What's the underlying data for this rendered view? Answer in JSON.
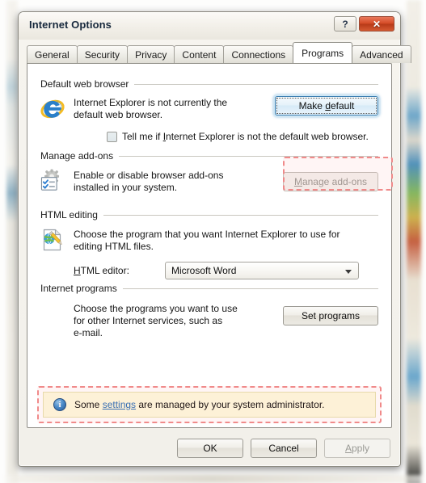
{
  "window": {
    "title": "Internet Options",
    "help_button": "?",
    "close_button": "✕"
  },
  "tabs": [
    {
      "label": "General",
      "active": false
    },
    {
      "label": "Security",
      "active": false
    },
    {
      "label": "Privacy",
      "active": false
    },
    {
      "label": "Content",
      "active": false
    },
    {
      "label": "Connections",
      "active": false
    },
    {
      "label": "Programs",
      "active": true
    },
    {
      "label": "Advanced",
      "active": false
    }
  ],
  "sections": {
    "default_browser": {
      "heading": "Default web browser",
      "icon": "internet-explorer-icon",
      "description_line1": "Internet Explorer is not currently the",
      "description_line2": "default web browser.",
      "button_label": "Make default",
      "button_accel": "d",
      "button_state": "focused",
      "checkbox_label_pre": "Tell me if ",
      "checkbox_accel": "I",
      "checkbox_label_post": "nternet Explorer is not the default web browser.",
      "checkbox_checked": false
    },
    "manage_addons": {
      "heading": "Manage add-ons",
      "icon": "addons-gear-icon",
      "description_line1": "Enable or disable browser add-ons",
      "description_line2": "installed in your system.",
      "button_accel": "M",
      "button_label_post": "anage add-ons",
      "button_state": "disabled",
      "highlighted": true
    },
    "html_editing": {
      "heading": "HTML editing",
      "icon": "html-edit-icon",
      "description_line1": "Choose the program that you want Internet Explorer to use for",
      "description_line2": "editing HTML files.",
      "editor_label_accel": "H",
      "editor_label_post": "TML editor:",
      "editor_value": "Microsoft Word",
      "editor_options": [
        "Microsoft Word"
      ]
    },
    "internet_programs": {
      "heading": "Internet programs",
      "description_line1": "Choose the programs you want to use",
      "description_line2": "for other Internet services, such as",
      "description_line3": "e-mail.",
      "button_label": "Set programs"
    }
  },
  "infobar": {
    "icon": "info-icon",
    "text_before": "Some ",
    "link_text": "settings",
    "text_after": " are managed by your system administrator.",
    "highlighted": true
  },
  "footer": {
    "ok_label": "OK",
    "cancel_label": "Cancel",
    "apply_accel": "A",
    "apply_label_post": "pply",
    "apply_state": "disabled"
  },
  "colors": {
    "highlight": "#f08a8a",
    "infobar_bg": "#fdfbdf",
    "link": "#2b6fb8",
    "close_red": "#d44a25"
  }
}
